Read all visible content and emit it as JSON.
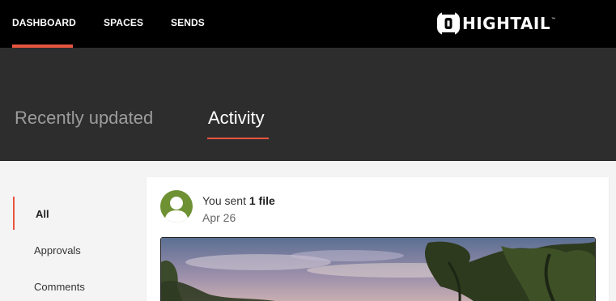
{
  "nav": {
    "items": [
      {
        "label": "DASHBOARD",
        "active": true
      },
      {
        "label": "SPACES",
        "active": false
      },
      {
        "label": "SENDS",
        "active": false
      }
    ],
    "logo_text": "HIGHTAIL",
    "logo_tm": "™",
    "accent": "#e8553e"
  },
  "header": {
    "tabs": [
      {
        "label": "Recently updated",
        "active": false
      },
      {
        "label": "Activity",
        "active": true
      }
    ]
  },
  "filters": {
    "items": [
      {
        "label": "All",
        "active": true
      },
      {
        "label": "Approvals",
        "active": false
      },
      {
        "label": "Comments",
        "active": false
      }
    ]
  },
  "activity": {
    "prefix": "You sent ",
    "count_text": "1 file",
    "date": "Apr 26",
    "avatar_color": "#6d9133",
    "avatar_icon": "user-silhouette-icon",
    "preview_icon": "image-thumbnail"
  }
}
